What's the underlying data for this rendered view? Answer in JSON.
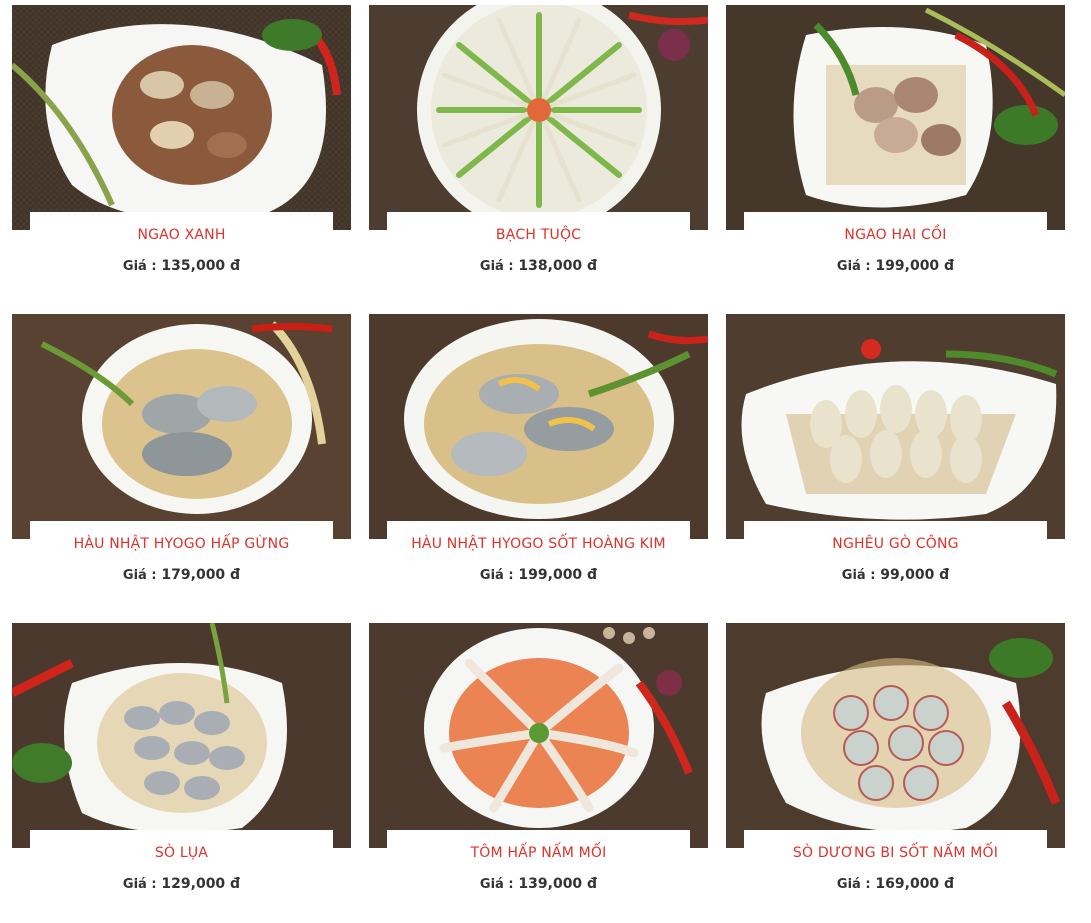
{
  "price_label": "Giá :",
  "products": [
    {
      "name": "NGAO XANH",
      "price": "135,000 đ",
      "icon": "clams-dish-image"
    },
    {
      "name": "BẠCH TUỘC",
      "price": "138,000 đ",
      "icon": "octopus-dish-image"
    },
    {
      "name": "NGAO HAI CỒI",
      "price": "199,000 đ",
      "icon": "clams-dish-image"
    },
    {
      "name": "HÀU NHẬT HYOGO HẤP GỪNG",
      "price": "179,000 đ",
      "icon": "oysters-dish-image"
    },
    {
      "name": "HÀU NHẬT HYOGO SỐT HOÀNG KIM",
      "price": "199,000 đ",
      "icon": "oysters-dish-image"
    },
    {
      "name": "NGHÊU GÒ CÔNG",
      "price": "99,000 đ",
      "icon": "clams-dish-image"
    },
    {
      "name": "SÒ LỤA",
      "price": "129,000 đ",
      "icon": "clams-dish-image"
    },
    {
      "name": "TÔM HẤP NẤM MỐI",
      "price": "139,000 đ",
      "icon": "shrimp-dish-image"
    },
    {
      "name": "SÒ DƯƠNG BI SỐT NẤM MỐI",
      "price": "169,000 đ",
      "icon": "scallops-dish-image"
    }
  ],
  "colors": {
    "name_text": "#e0312a",
    "price_text": "#333333",
    "burlap": "#4a3b2f",
    "plate": "#f6f6f4"
  }
}
